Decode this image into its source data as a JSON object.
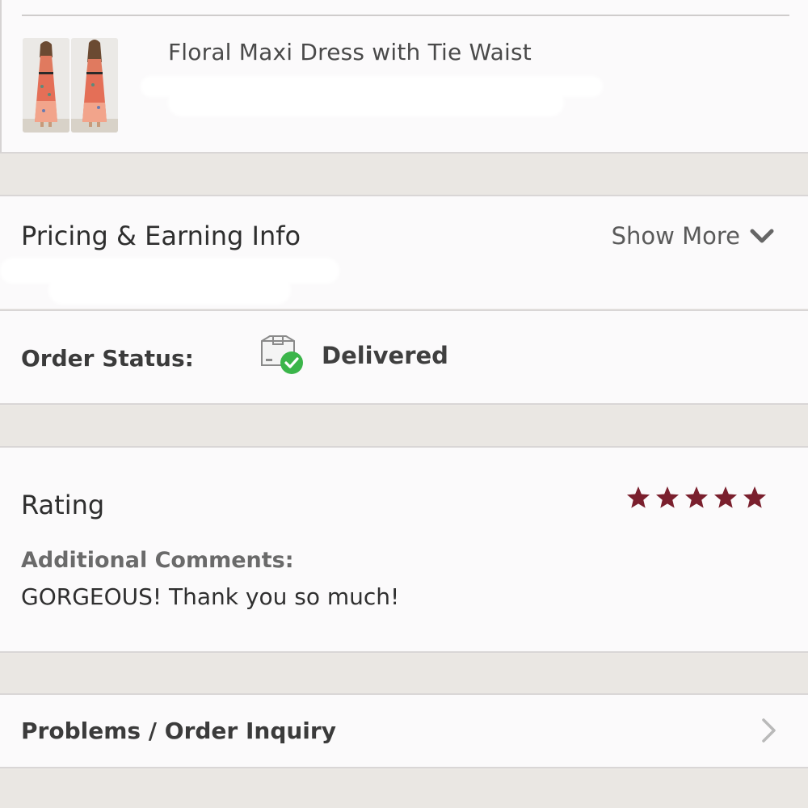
{
  "product": {
    "title": "Floral Maxi Dress with Tie Waist",
    "thumbnails": [
      "dress-front-photo",
      "dress-back-photo"
    ]
  },
  "pricing": {
    "title": "Pricing & Earning Info",
    "show_more_label": "Show More",
    "show_more_icon": "chevron-down-icon"
  },
  "order_status": {
    "label": "Order Status:",
    "value": "Delivered",
    "icon": "package-delivered-icon",
    "accent_color": "#3bb54a"
  },
  "rating": {
    "title": "Rating",
    "stars": 5,
    "max_stars": 5,
    "star_color": "#7a1f2d",
    "comments_label": "Additional Comments:",
    "comments_text": "GORGEOUS! Thank you so much!"
  },
  "problems": {
    "label": "Problems / Order Inquiry",
    "icon": "chevron-right-icon"
  }
}
